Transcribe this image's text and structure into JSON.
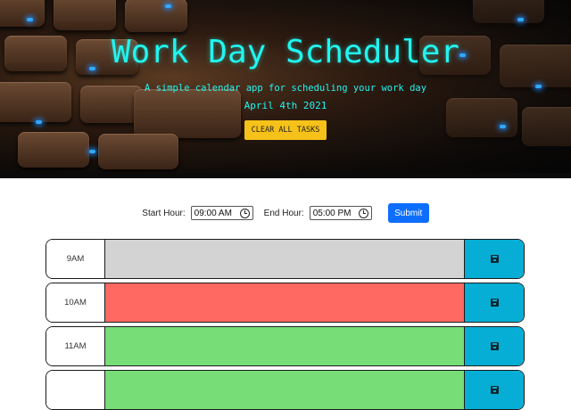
{
  "header": {
    "title": "Work Day Scheduler",
    "subtitle": "A simple calendar app for scheduling your work day",
    "date": "April 4th 2021",
    "clear_label": "CLEAR ALL TASKS"
  },
  "hours_form": {
    "start_label": "Start Hour:",
    "start_value": "09:00 AM",
    "end_label": "End Hour:",
    "end_value": "05:00 PM",
    "submit_label": "Submit"
  },
  "colors": {
    "past": "#d3d3d3",
    "present": "#ff6961",
    "future": "#77dd77",
    "save": "#06aed5",
    "accent_text": "#21f5f0",
    "clear_button": "#f6c21a",
    "submit_button": "#0d6efd"
  },
  "rows": [
    {
      "hour": "9AM",
      "state": "past",
      "task": "",
      "save_icon": "save-icon"
    },
    {
      "hour": "10AM",
      "state": "present",
      "task": "",
      "save_icon": "save-icon"
    },
    {
      "hour": "11AM",
      "state": "future",
      "task": "",
      "save_icon": "save-icon"
    },
    {
      "hour": "",
      "state": "future",
      "task": "",
      "save_icon": "save-icon"
    }
  ]
}
